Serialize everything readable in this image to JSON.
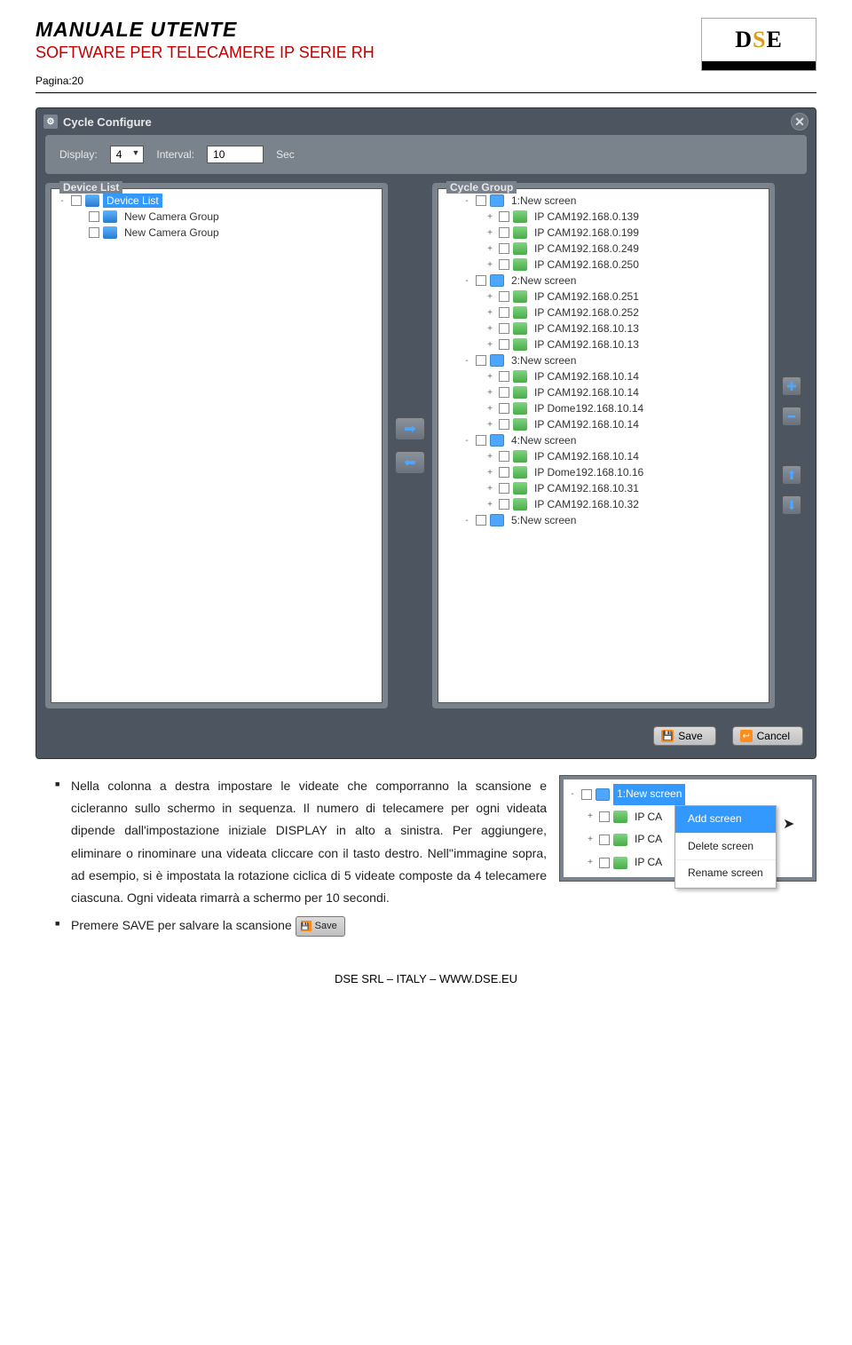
{
  "header": {
    "title": "MANUALE UTENTE",
    "subtitle": "SOFTWARE PER TELECAMERE IP SERIE RH",
    "page": "Pagina:20",
    "logo_text": "DSE"
  },
  "window": {
    "title": "Cycle Configure",
    "display_label": "Display:",
    "display_value": "4",
    "interval_label": "Interval:",
    "interval_value": "10",
    "sec_label": "Sec",
    "device_list_title": "Device List",
    "cycle_group_title": "Cycle Group",
    "device_list_root": "Device List",
    "device_list_items": [
      "New Camera Group",
      "New Camera Group"
    ],
    "cycle_groups": [
      {
        "name": "1:New screen",
        "cams": [
          "IP CAM192.168.0.139",
          "IP CAM192.168.0.199",
          "IP CAM192.168.0.249",
          "IP CAM192.168.0.250"
        ]
      },
      {
        "name": "2:New screen",
        "cams": [
          "IP CAM192.168.0.251",
          "IP CAM192.168.0.252",
          "IP CAM192.168.10.13",
          "IP CAM192.168.10.13"
        ]
      },
      {
        "name": "3:New screen",
        "cams": [
          "IP CAM192.168.10.14",
          "IP CAM192.168.10.14",
          "IP Dome192.168.10.14",
          "IP CAM192.168.10.14"
        ]
      },
      {
        "name": "4:New screen",
        "cams": [
          "IP CAM192.168.10.14",
          "IP Dome192.168.10.16",
          "IP CAM192.168.10.31",
          "IP CAM192.168.10.32"
        ]
      },
      {
        "name": "5:New screen",
        "cams": []
      }
    ],
    "save_label": "Save",
    "cancel_label": "Cancel"
  },
  "context_popup": {
    "header_item": "1:New screen",
    "items": [
      "IP CA",
      "IP CA",
      "IP CA"
    ],
    "menu": [
      "Add screen",
      "Delete screen",
      "Rename screen"
    ]
  },
  "paragraphs": {
    "p1": "Nella colonna a destra impostare le videate che comporranno la scansione e cicleranno sullo schermo in sequenza. Il numero di telecamere per ogni videata dipende dall'impostazione iniziale DISPLAY in alto a sinistra. Per aggiungere, eliminare o rinominare una videata cliccare con il tasto destro. Nell''immagine sopra, ad esempio, si è impostata la rotazione ciclica di 5 videate composte da 4 telecamere ciascuna. Ogni videata rimarrà a schermo per 10 secondi.",
    "p2_prefix": "Premere SAVE per salvare la scansione",
    "inline_btn": "Save"
  },
  "footer": "DSE SRL – ITALY – WWW.DSE.EU"
}
